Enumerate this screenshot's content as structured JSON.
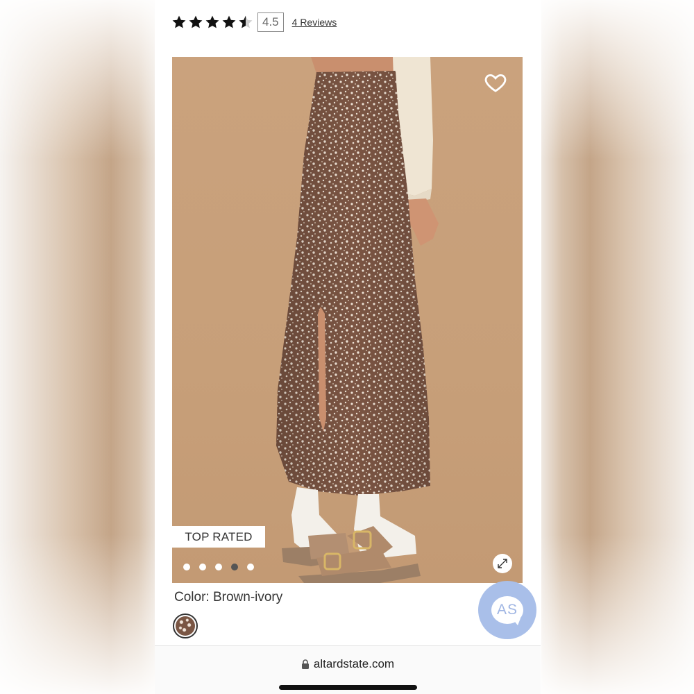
{
  "rating": {
    "value": 4.5,
    "display": "4.5",
    "stars_total": 5,
    "reviews_link": "4 Reviews"
  },
  "gallery": {
    "icons": {
      "favorite": "heart-outline-icon",
      "expand": "expand-arrows-icon"
    },
    "badge": "TOP RATED",
    "dots_total": 5,
    "active_index": 3
  },
  "product": {
    "color_label": "Color: Brown-ivory",
    "swatch": "brown-ivory-floral"
  },
  "chat": {
    "label": "AS",
    "icon": "chat-bubble-icon"
  },
  "browser": {
    "url": "altardstate.com",
    "icon": "lock-icon"
  },
  "colors": {
    "chat_bg": "#a9bfe9",
    "image_bg": "#c8a07b",
    "skirt": "#7a5644"
  }
}
